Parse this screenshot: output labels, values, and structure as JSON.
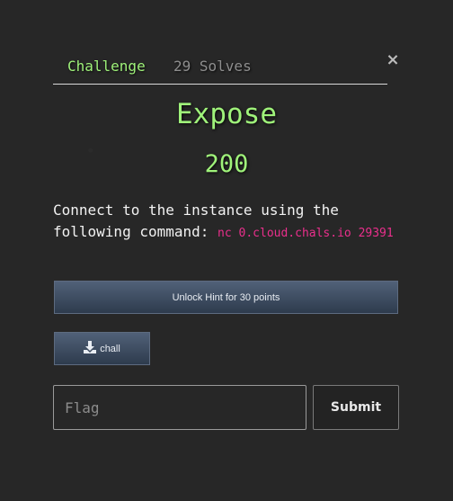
{
  "tabs": {
    "challenge": "Challenge",
    "solves": "29 Solves"
  },
  "close": {
    "icon": "×"
  },
  "challenge": {
    "name": "Expose",
    "points": "200",
    "description_text": "Connect to the instance using the following command: ",
    "command": "nc 0.cloud.chals.io 29391"
  },
  "hint": {
    "label": "Unlock Hint for 30 points"
  },
  "file": {
    "icon": "download-icon",
    "label": "chall"
  },
  "flag": {
    "placeholder": "Flag",
    "value": ""
  },
  "submit": {
    "label": "Submit"
  },
  "colors": {
    "accent": "#9ff27a",
    "command": "#ea2f8c",
    "button": "#3e4a5c"
  }
}
